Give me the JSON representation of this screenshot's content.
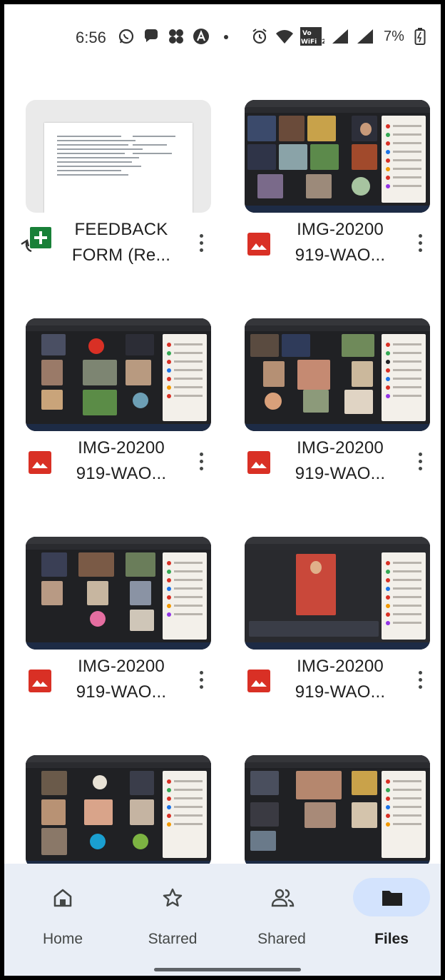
{
  "status_bar": {
    "time": "6:56",
    "battery_percent": "7%",
    "wifi_label": "Vo WiFi 2",
    "icons_left": [
      "whatsapp-icon",
      "chat-bubble-icon",
      "fan-icon",
      "a-circle-icon",
      "dot-icon"
    ],
    "icons_right": [
      "alarm-icon",
      "wifi-icon",
      "vowifi-icon",
      "signal-icon",
      "signal-icon",
      "battery-icon"
    ]
  },
  "files": [
    {
      "name_line1": "FEEDBACK",
      "name_line2": "FORM (Re...",
      "type": "sheets",
      "thumbnail": "document-preview"
    },
    {
      "name_line1": "IMG-20200",
      "name_line2": "919-WAO...",
      "type": "image",
      "thumbnail": "video-call-screenshot"
    },
    {
      "name_line1": "IMG-20200",
      "name_line2": "919-WAO...",
      "type": "image",
      "thumbnail": "video-call-screenshot"
    },
    {
      "name_line1": "IMG-20200",
      "name_line2": "919-WAO...",
      "type": "image",
      "thumbnail": "video-call-screenshot"
    },
    {
      "name_line1": "IMG-20200",
      "name_line2": "919-WAO...",
      "type": "image",
      "thumbnail": "video-call-screenshot"
    },
    {
      "name_line1": "IMG-20200",
      "name_line2": "919-WAO...",
      "type": "image",
      "thumbnail": "video-call-screenshot"
    },
    {
      "name_line1": "",
      "name_line2": "",
      "type": "image",
      "thumbnail": "video-call-screenshot"
    },
    {
      "name_line1": "",
      "name_line2": "",
      "type": "image",
      "thumbnail": "video-call-screenshot"
    }
  ],
  "bottom_nav": {
    "items": [
      {
        "label": "Home",
        "icon": "home-icon",
        "active": false
      },
      {
        "label": "Starred",
        "icon": "star-icon",
        "active": false
      },
      {
        "label": "Shared",
        "icon": "people-icon",
        "active": false
      },
      {
        "label": "Files",
        "icon": "folder-icon",
        "active": true
      }
    ]
  },
  "colors": {
    "image_icon_red": "#d93025",
    "sheets_green": "#188038",
    "nav_background": "#e9eef6",
    "nav_active_pill": "#d3e3fd"
  }
}
